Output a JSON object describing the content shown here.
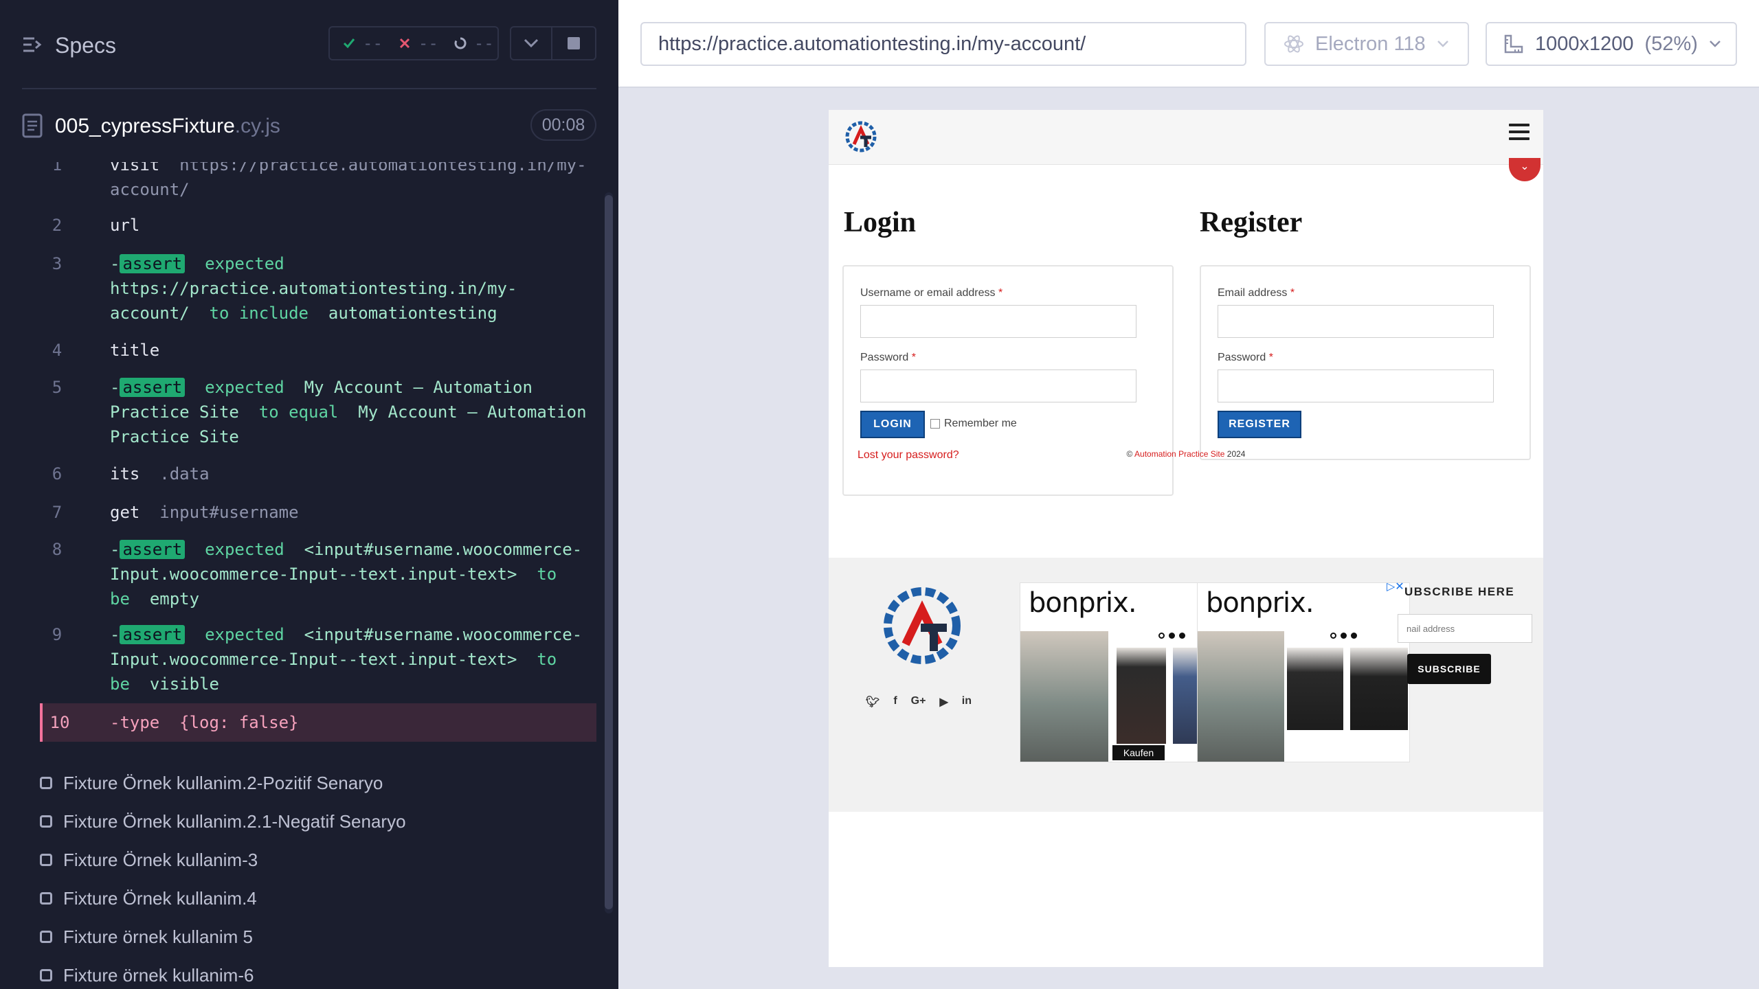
{
  "reporter": {
    "specs_label": "Specs",
    "stats": {
      "passed": "--",
      "failed": "--",
      "pending": "--"
    },
    "file_name": "005_cypressFixture",
    "file_ext": ".cy.js",
    "duration": "00:08",
    "commands": [
      {
        "num": "1",
        "name": "visit",
        "arg": "https://practice.automationtesting.in/my-account/"
      },
      {
        "num": "2",
        "name": "url"
      },
      {
        "num": "3",
        "prefix": "-",
        "badge": "assert",
        "text1": "expected",
        "val1": "https://practice.automationtesting.in/my-account/",
        "op": "to include",
        "val2": "automationtesting"
      },
      {
        "num": "4",
        "name": "title"
      },
      {
        "num": "5",
        "prefix": "-",
        "badge": "assert",
        "text1": "expected",
        "val1": "My Account – Automation Practice Site",
        "op": "to equal",
        "val2": "My Account – Automation Practice Site"
      },
      {
        "num": "6",
        "name": "its",
        "arg": ".data"
      },
      {
        "num": "7",
        "name": "get",
        "arg": "input#username"
      },
      {
        "num": "8",
        "prefix": "-",
        "badge": "assert",
        "text1": "expected",
        "val1": "<input#username.woocommerce-Input.woocommerce-Input--text.input-text>",
        "op": "to be",
        "val2": "empty"
      },
      {
        "num": "9",
        "prefix": "-",
        "badge": "assert",
        "text1": "expected",
        "val1": "<input#username.woocommerce-Input.woocommerce-Input--text.input-text>",
        "op": "to be",
        "val2": "visible"
      },
      {
        "num": "10",
        "name": "-type",
        "arg": "{log: false}"
      }
    ],
    "tests": [
      "Fixture Örnek kullanim.2-Pozitif Senaryo",
      "Fixture Örnek kullanim.2.1-Negatif Senaryo",
      "Fixture Örnek kullanim-3",
      "Fixture Örnek kullanim.4",
      "Fixture örnek kullanim 5",
      "Fixture örnek kullanim-6"
    ]
  },
  "aut": {
    "url": "https://practice.automationtesting.in/my-account/",
    "browser": "Electron 118",
    "viewport": "1000x1200",
    "zoom": "(52%)"
  },
  "page": {
    "login_title": "Login",
    "register_title": "Register",
    "username_label": "Username or email address",
    "password_label": "Password",
    "email_label": "Email address",
    "required_mark": "*",
    "login_button": "LOGIN",
    "remember_me": "Remember me",
    "lost_password": "Lost your password?",
    "register_button": "REGISTER",
    "ad_brand": "bonprix.",
    "ad_cta": "Kaufen",
    "subscribe_title": "UBSCRIBE HERE",
    "subscribe_placeholder": "nail address",
    "subscribe_button": "SUBSCRIBE",
    "copyright_prefix": "©",
    "copyright_link": "Automation Practice Site",
    "copyright_year": "2024"
  },
  "colors": {
    "reporter_bg": "#1b1e2e",
    "assert_badge": "#1fa971",
    "active_command": "#3a2739",
    "button_blue": "#1e64b4",
    "link_red": "#d61d1d"
  }
}
